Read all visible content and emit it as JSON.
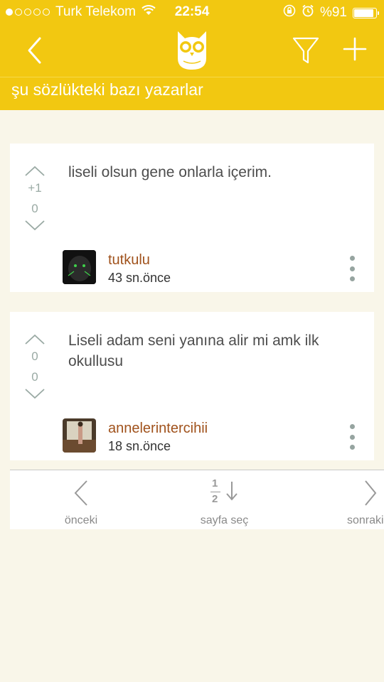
{
  "status_bar": {
    "carrier": "Turk Telekom",
    "time": "22:54",
    "battery_percent_label": "%91",
    "battery_level": 0.91
  },
  "nav": {
    "back_icon": "chevron-left-icon",
    "logo_icon": "owl-logo-icon",
    "filter_icon": "filter-icon",
    "add_icon": "plus-icon"
  },
  "topic": {
    "title": "şu sözlükteki bazı yazarlar"
  },
  "entries": [
    {
      "upvotes": "+1",
      "downvotes": "0",
      "text": "liseli olsun gene onlarla içerim.",
      "author": "tutkulu",
      "time": "43 sn.önce"
    },
    {
      "upvotes": "0",
      "downvotes": "0",
      "text": "Liseli adam seni yanına alir mi amk ilk okullusu",
      "author": "annelerintercihii",
      "time": "18 sn.önce"
    }
  ],
  "pager": {
    "prev_label": "önceki",
    "page_select_label": "sayfa seç",
    "next_label": "sonraki",
    "page_icon_digits": [
      "1",
      "2"
    ]
  },
  "colors": {
    "brand_yellow": "#f2c811",
    "background": "#f9f6e9",
    "author_color": "#a0521c",
    "vote_color": "#9aaaa4"
  }
}
